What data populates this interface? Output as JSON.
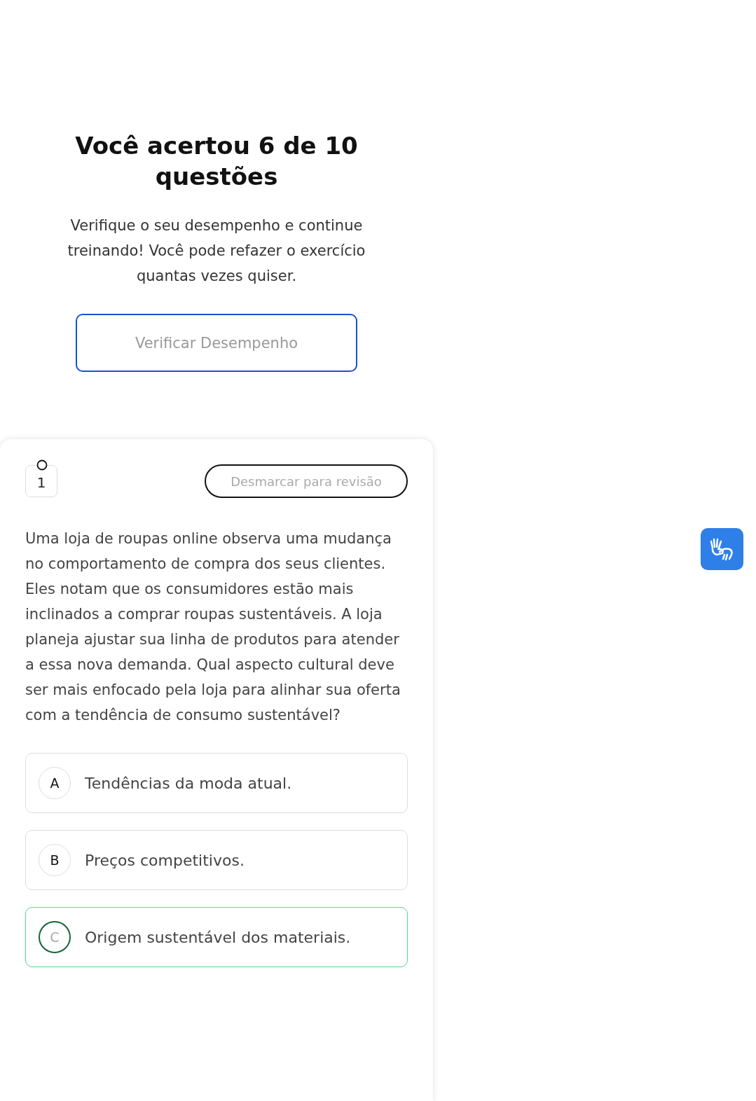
{
  "result": {
    "title": "Você acertou 6 de 10 questões",
    "description": "Verifique o seu desempenho e continue treinando! Você pode refazer o exercício quantas vezes quiser.",
    "button": "Verificar Desempenho"
  },
  "question": {
    "number": "1",
    "review_button": "Desmarcar para revisão",
    "text": "Uma loja de roupas online observa uma mudança no comportamento de compra dos seus clientes. Eles notam que os consumidores estão mais inclinados a comprar roupas sustentáveis. A loja planeja ajustar sua linha de produtos para atender a essa nova demanda. Qual aspecto cultural deve ser mais enfocado pela loja para alinhar sua oferta com a tendência de consumo sustentável?",
    "options": [
      {
        "letter": "A",
        "text": "Tendências da moda atual.",
        "selected": false
      },
      {
        "letter": "B",
        "text": "Preços competitivos.",
        "selected": false
      },
      {
        "letter": "C",
        "text": "Origem sustentável dos materiais.",
        "selected": true
      }
    ]
  }
}
